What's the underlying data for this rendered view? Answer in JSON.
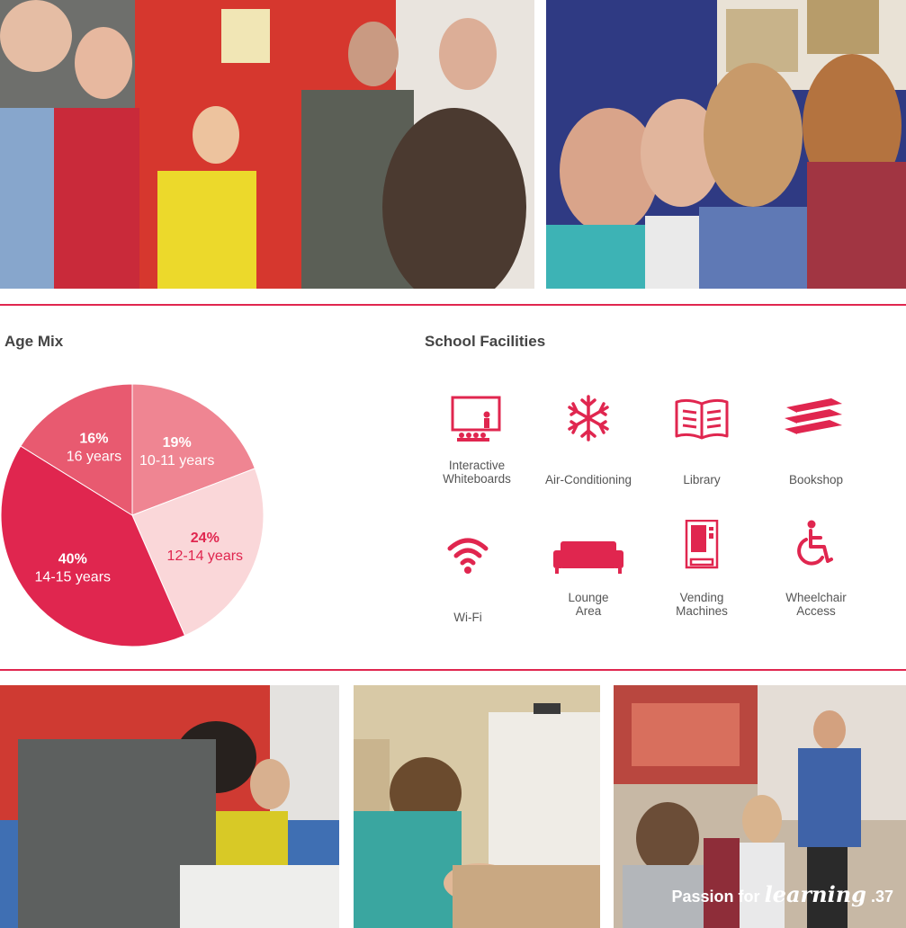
{
  "sections": {
    "age_mix_title": "Age Mix",
    "facilities_title": "School Facilities"
  },
  "chart_data": {
    "type": "pie",
    "title": "Age Mix",
    "slices": [
      {
        "percent": "19%",
        "label": "10-11 years",
        "value": 19,
        "color": "#ef8592"
      },
      {
        "percent": "24%",
        "label": "12-14 years",
        "value": 24,
        "color": "#fad7d9"
      },
      {
        "percent": "40%",
        "label": "14-15 years",
        "value": 40,
        "color": "#e0264f"
      },
      {
        "percent": "16%",
        "label": "16 years",
        "value": 16,
        "color": "#e85a70"
      }
    ]
  },
  "facilities": [
    {
      "icon": "whiteboard-icon",
      "line1": "Interactive",
      "line2": "Whiteboards"
    },
    {
      "icon": "snowflake-icon",
      "line1": "Air-Conditioning",
      "line2": ""
    },
    {
      "icon": "book-icon",
      "line1": "Library",
      "line2": ""
    },
    {
      "icon": "books-stack-icon",
      "line1": "Bookshop",
      "line2": ""
    },
    {
      "icon": "wifi-icon",
      "line1": "Wi-Fi",
      "line2": ""
    },
    {
      "icon": "sofa-icon",
      "line1": "Lounge",
      "line2": "Area"
    },
    {
      "icon": "vending-machine-icon",
      "line1": "Vending",
      "line2": "Machines"
    },
    {
      "icon": "wheelchair-icon",
      "line1": "Wheelchair",
      "line2": "Access"
    }
  ],
  "footer": {
    "prefix": "Passion for",
    "script_word": "learning",
    "page_number": ".37"
  },
  "colors": {
    "accent": "#e0264f",
    "tab": "#2f7fc1"
  }
}
